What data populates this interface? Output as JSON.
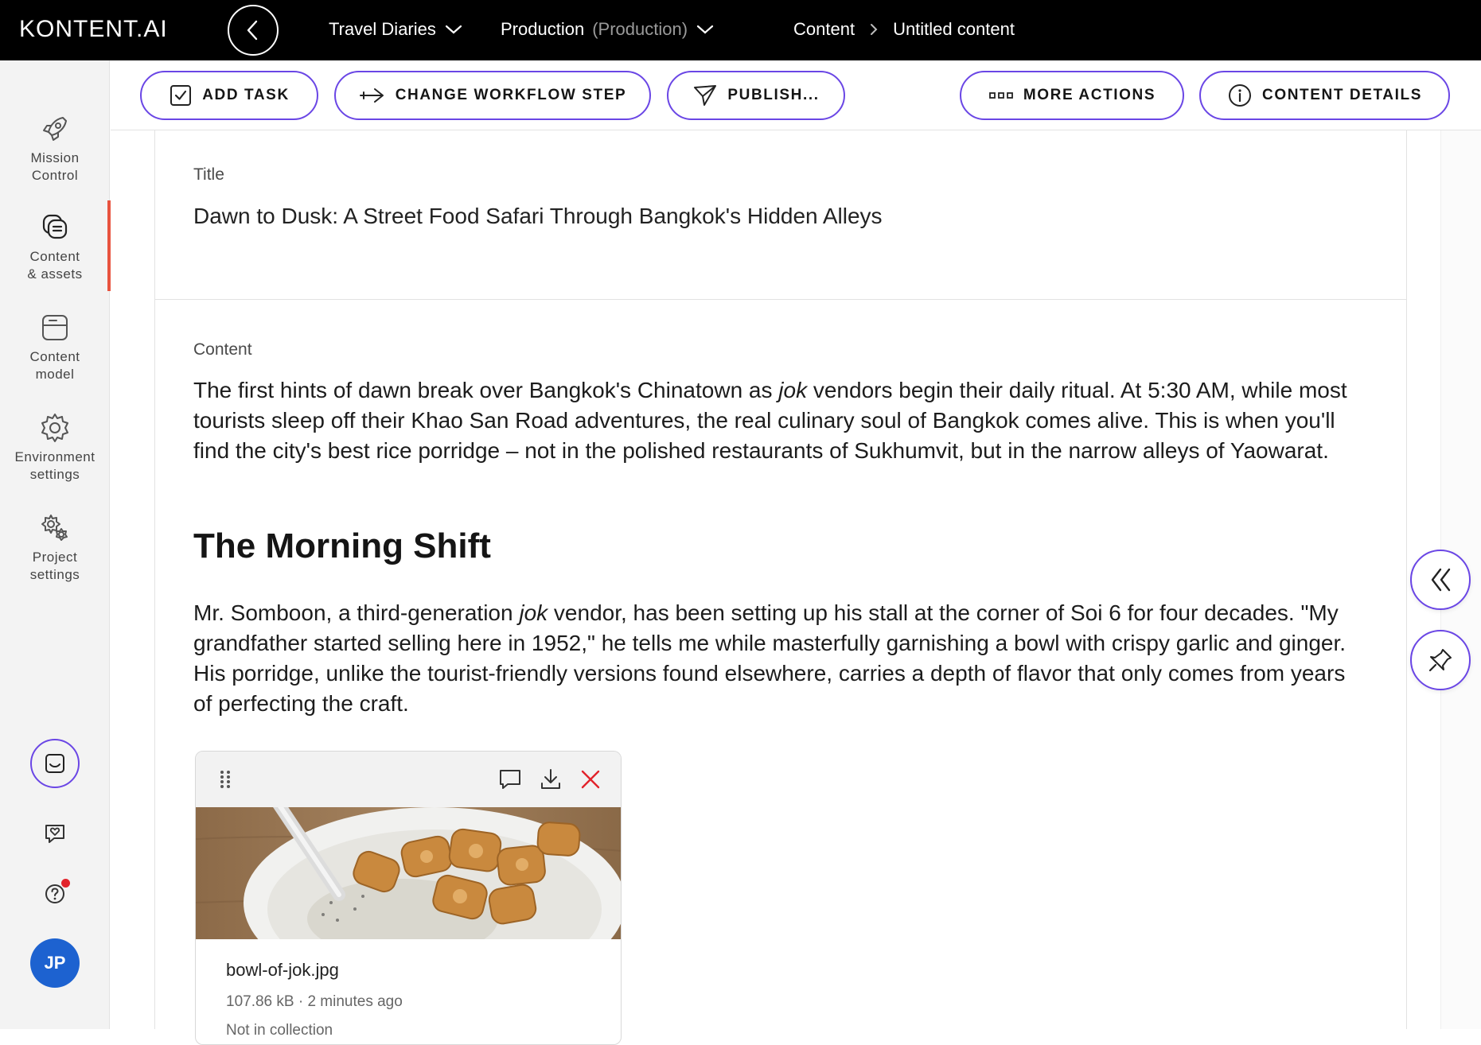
{
  "app": {
    "logo": "KONTENT.AI",
    "project": "Travel Diaries",
    "environment": "Production",
    "environment_type": "(Production)",
    "breadcrumb": [
      "Content",
      "Untitled content"
    ]
  },
  "sidebar": {
    "items": [
      {
        "label": "Mission\nControl",
        "icon": "rocket-icon"
      },
      {
        "label": "Content\n& assets",
        "icon": "content-assets-icon",
        "active": true
      },
      {
        "label": "Content\nmodel",
        "icon": "content-model-icon"
      },
      {
        "label": "Environment\nsettings",
        "icon": "gear-icon"
      },
      {
        "label": "Project\nsettings",
        "icon": "gears-icon"
      }
    ],
    "user_initials": "JP"
  },
  "toolbar": {
    "add_task": "ADD TASK",
    "change_workflow": "CHANGE WORKFLOW STEP",
    "publish": "PUBLISH...",
    "more_actions": "MORE ACTIONS",
    "content_details": "CONTENT DETAILS"
  },
  "editor": {
    "title_label": "Title",
    "title_value": "Dawn to Dusk: A Street Food Safari Through Bangkok's Hidden Alleys",
    "content_label": "Content",
    "para1": {
      "before": "The first hints of dawn break over Bangkok's Chinatown as ",
      "em": "jok",
      "after": " vendors begin their daily ritual. At 5:30 AM, while most tourists sleep off their Khao San Road adventures, the real culinary soul of Bangkok comes alive. This is when you'll find the city's best rice porridge – not in the polished restaurants of Sukhumvit, but in the narrow alleys of Yaowarat."
    },
    "heading": "The Morning Shift",
    "para2": {
      "before": "Mr. Somboon, a third-generation ",
      "em": "jok",
      "after": " vendor, has been setting up his stall at the corner of Soi 6 for four decades. \"My grandfather started selling here in 1952,\" he tells me while masterfully garnishing a bowl with crispy garlic and ginger. His porridge, unlike the tourist-friendly versions found elsewhere, carries a depth of flavor that only comes from years of perfecting the craft."
    },
    "asset": {
      "filename": "bowl-of-jok.jpg",
      "meta": "107.86 kB · 2 minutes ago",
      "extra": "Not in collection"
    }
  },
  "colors": {
    "accent": "#6a46e5",
    "active_marker": "#e8533f",
    "avatar": "#1d62d0",
    "notification": "#e2232b"
  }
}
